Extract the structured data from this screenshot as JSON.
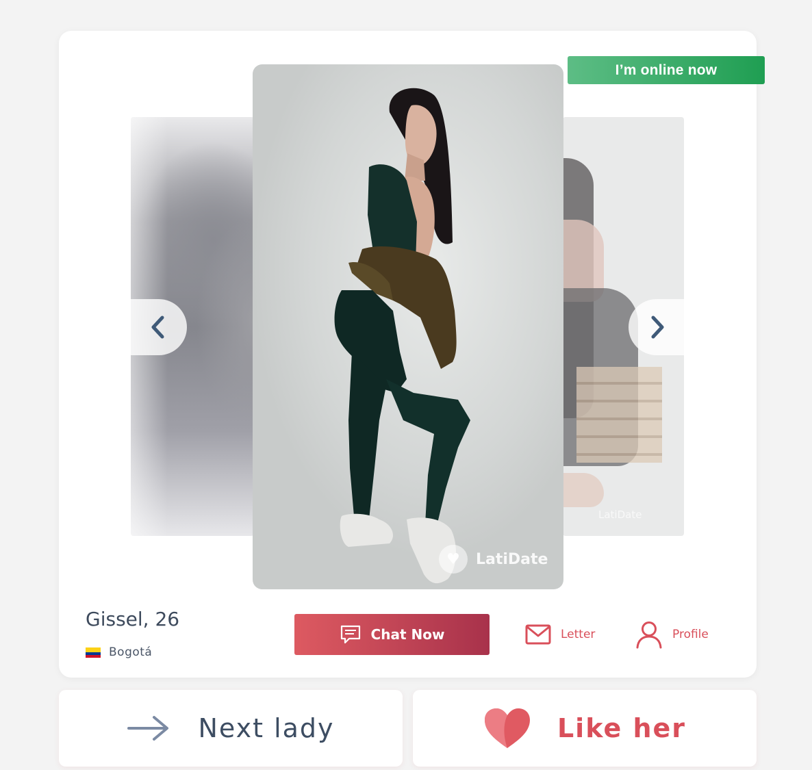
{
  "profile": {
    "name_age": "Gissel, 26",
    "city": "Bogotá",
    "flag_icon": "colombia-flag-icon",
    "online_status": "I’m online now"
  },
  "gallery": {
    "watermark": "LatiDate",
    "side_watermark": "LatiDate",
    "prev_icon": "chevron-left-icon",
    "next_icon": "chevron-right-icon"
  },
  "actions": {
    "chat_label": "Chat Now",
    "letter_label": "Letter",
    "profile_label": "Profile"
  },
  "bottom": {
    "next_label": "Next lady",
    "like_label": "Like her"
  },
  "colors": {
    "accent_red": "#d94f5a",
    "online_green": "#1f9e52",
    "text_dark": "#3d4a5c"
  }
}
